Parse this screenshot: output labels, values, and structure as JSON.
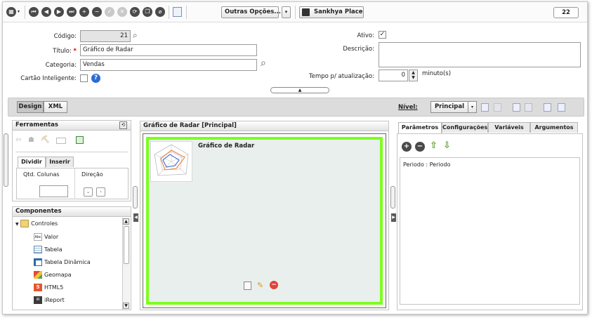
{
  "toolbar": {
    "more_options_label": "Outras Opções...",
    "sankhya_place_label": "Sankhya Place",
    "badge_count": "22"
  },
  "form": {
    "codigo_label": "Código:",
    "codigo_value": "21",
    "titulo_label": "Título:",
    "titulo_value": "Gráfico de Radar",
    "categoria_label": "Categoria:",
    "categoria_value": "Vendas",
    "cartao_label": "Cartão Inteligente:",
    "ativo_label": "Ativo:",
    "ativo_checked": true,
    "descricao_label": "Descrição:",
    "descricao_value": "",
    "tempo_label": "Tempo p/ atualização:",
    "tempo_value": "0",
    "tempo_unit": "minuto(s)"
  },
  "design_bar": {
    "design_label": "Design",
    "xml_label": "XML",
    "nivel_label": "Nível:",
    "nivel_value": "Principal"
  },
  "tools_panel": {
    "title": "Ferramentas",
    "tab_divide": "Dividir",
    "tab_insert": "Inserir",
    "qtd_colunas_label": "Qtd. Colunas",
    "direcao_label": "Direção"
  },
  "components_panel": {
    "title": "Componentes",
    "root_label": "Controles",
    "items": [
      {
        "label": "Valor",
        "icon": "abc-value-icon"
      },
      {
        "label": "Tabela",
        "icon": "table-icon"
      },
      {
        "label": "Tabela Dinâmica",
        "icon": "pivot-table-icon"
      },
      {
        "label": "Geomapa",
        "icon": "geomap-icon"
      },
      {
        "label": "HTML5",
        "icon": "html5-icon"
      },
      {
        "label": "iReport",
        "icon": "ireport-icon"
      }
    ]
  },
  "canvas_panel": {
    "title": "Gráfico de Radar [Principal]",
    "chart_label": "Gráfico de Radar"
  },
  "right_panel": {
    "tabs": [
      "Parâmetros",
      "Configurações",
      "Variáveis",
      "Argumentos"
    ],
    "param_entry": "Periodo : Periodo"
  },
  "colors": {
    "canvas_border": "#7cff1f",
    "canvas_bg": "#e9efec",
    "accent_blue": "#2c6bd6",
    "arrow_green": "#5aa02c",
    "remove_red": "#e0423a"
  }
}
